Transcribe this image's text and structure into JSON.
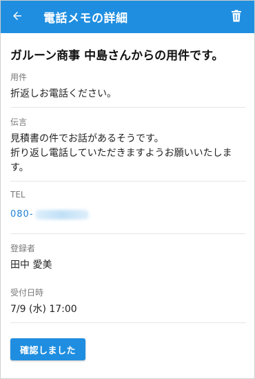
{
  "appbar": {
    "title": "電話メモの詳細",
    "back_icon": "arrow-left-icon",
    "delete_icon": "trash-icon"
  },
  "memo": {
    "subject": "ガルーン商事 中島さんからの用件です。",
    "fields": {
      "purpose_label": "用件",
      "purpose_value": "折返しお電話ください。",
      "message_label": "伝言",
      "message_line1": "見積書の件でお話があるそうです。",
      "message_line2": "折り返し電話していただきますようお願いいたしま",
      "message_line3": "す。",
      "tel_label": "TEL",
      "tel_prefix": "080-",
      "registrant_label": "登録者",
      "registrant_value": "田中 愛美",
      "received_label": "受付日時",
      "received_value": "7/9 (水) 17:00"
    }
  },
  "actions": {
    "confirm_label": "確認しました"
  },
  "colors": {
    "primary": "#1f8ee0",
    "link": "#1f7fd6"
  }
}
